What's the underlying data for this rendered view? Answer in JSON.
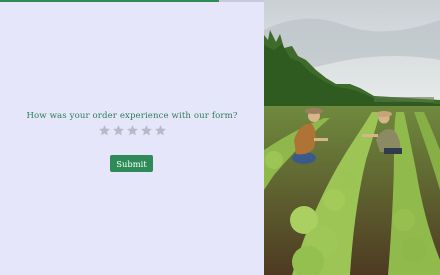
{
  "form": {
    "progress_fraction": 0.83,
    "question": "How was your order experience with our form?",
    "rating": {
      "max": 5,
      "value": 0,
      "star_color": "#b9b9c8"
    },
    "submit_label": "Submit",
    "accent_color": "#2e8b57"
  },
  "photo": {
    "subject": "two-farmers-in-lettuce-field-image"
  }
}
